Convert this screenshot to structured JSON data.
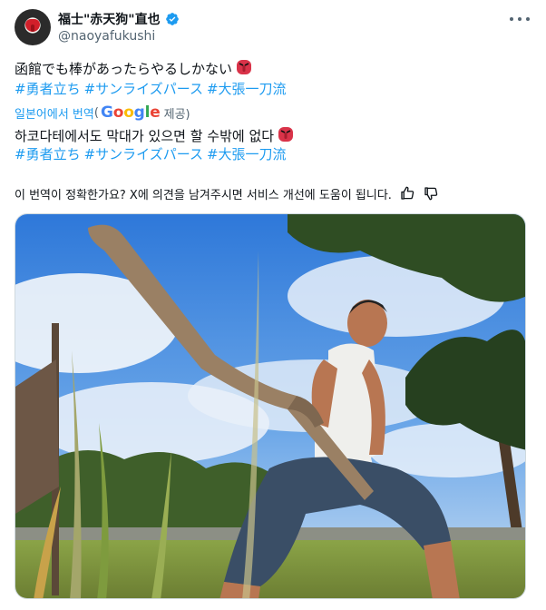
{
  "author": {
    "display_name": "福士\"赤天狗\"直也",
    "handle": "@naoyafukushi",
    "verified": true
  },
  "post": {
    "text": "函館でも棒があったらやるしかない",
    "hashtags": [
      "#勇者立ち",
      "#サンライズパース",
      "#大張一刀流"
    ]
  },
  "translation": {
    "prefix": "일본어에서 번역",
    "open_paren": "(",
    "google_G": "G",
    "google_o1": "o",
    "google_o2": "o",
    "google_g": "g",
    "google_l": "l",
    "google_e": "e",
    "suffix": " 제공)",
    "text": "하코다테에서도 막대가 있으면 할 수밖에 없다",
    "hashtags": [
      "#勇者立ち",
      "#サンライズパース",
      "#大張一刀流"
    ],
    "feedback_prompt": "이 번역이 정확한가요? X에 의견을 남겨주시면 서비스 개선에 도움이 됩니다."
  },
  "icons": {
    "verified": "verified-badge-icon",
    "more": "more-options-icon",
    "tengu": "tengu-mask-emoji",
    "thumbs_up": "thumbs-up-icon",
    "thumbs_down": "thumbs-down-icon"
  },
  "colors": {
    "link": "#1d9bf0",
    "secondary_text": "#536471",
    "primary_text": "#0f1419"
  }
}
